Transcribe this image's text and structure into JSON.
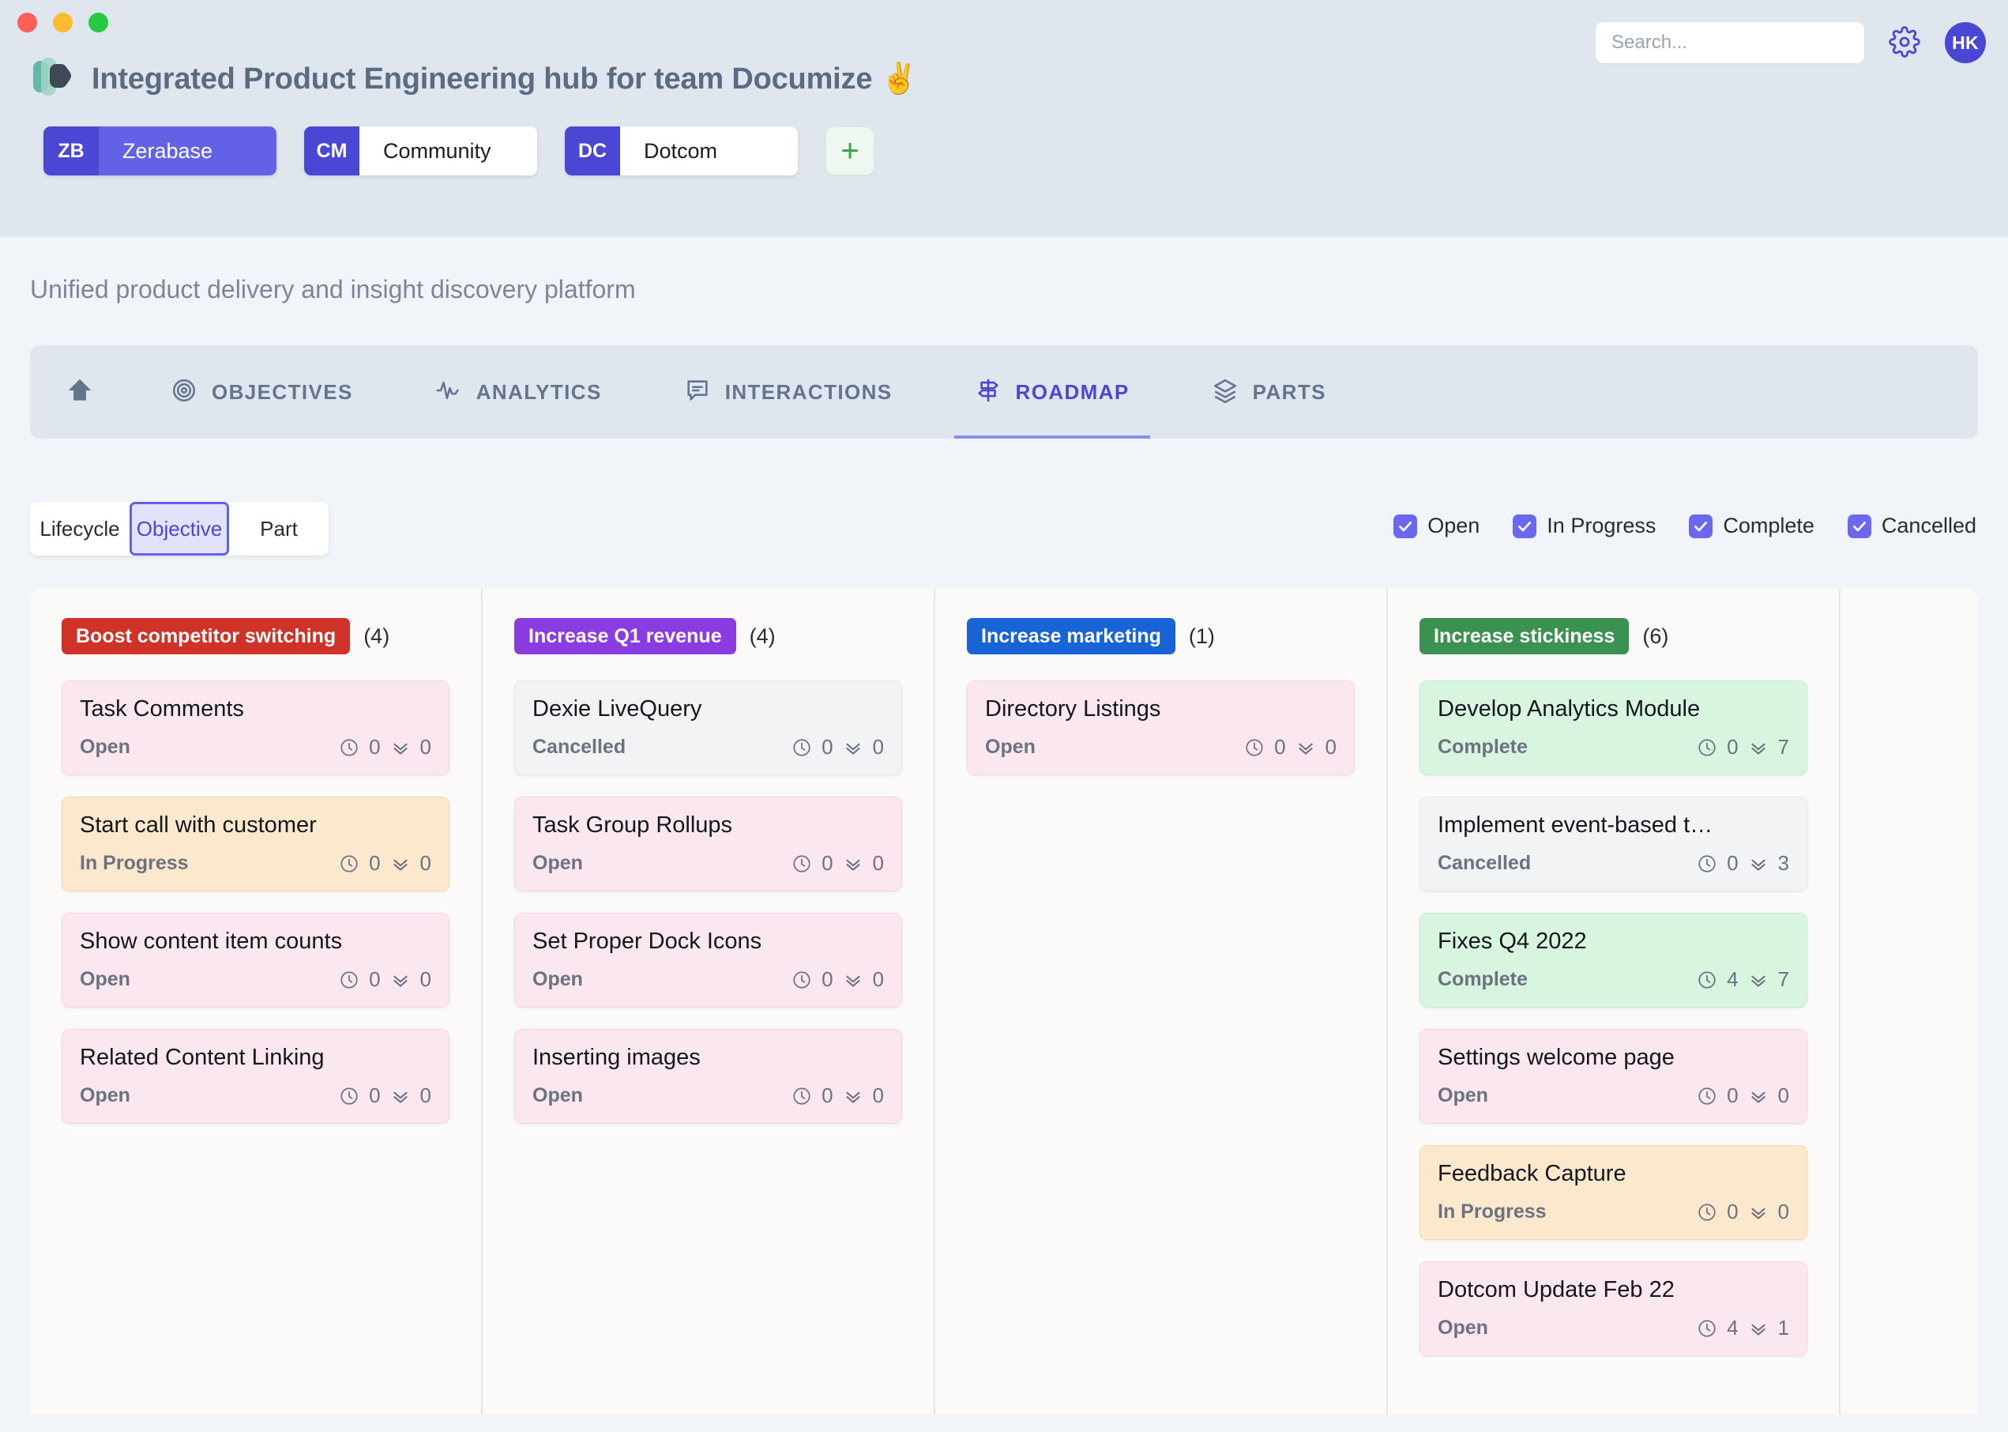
{
  "window": {
    "traffic_lights": [
      "close",
      "minimize",
      "maximize"
    ]
  },
  "header": {
    "title": "Integrated Product Engineering hub for team Documize ✌️",
    "logo_icon": "documize-logo-icon",
    "search": {
      "placeholder": "Search...",
      "value": ""
    },
    "settings_icon": "gear-icon",
    "avatar_initials": "HK"
  },
  "projects": {
    "items": [
      {
        "code": "ZB",
        "name": "Zerabase",
        "active": true
      },
      {
        "code": "CM",
        "name": "Community",
        "active": false
      },
      {
        "code": "DC",
        "name": "Dotcom",
        "active": false
      }
    ],
    "add_label": "+"
  },
  "subtitle": "Unified product delivery and insight discovery platform",
  "nav": {
    "items": [
      {
        "label": "",
        "icon": "home-icon",
        "active": false
      },
      {
        "label": "OBJECTIVES",
        "icon": "target-icon",
        "active": false
      },
      {
        "label": "ANALYTICS",
        "icon": "pulse-icon",
        "active": false
      },
      {
        "label": "INTERACTIONS",
        "icon": "comment-icon",
        "active": false
      },
      {
        "label": "ROADMAP",
        "icon": "signpost-icon",
        "active": true
      },
      {
        "label": "PARTS",
        "icon": "layers-icon",
        "active": false
      }
    ]
  },
  "group_by": {
    "options": [
      {
        "label": "Lifecycle",
        "active": false
      },
      {
        "label": "Objective",
        "active": true
      },
      {
        "label": "Part",
        "active": false
      }
    ]
  },
  "status_filters": [
    {
      "label": "Open",
      "checked": true
    },
    {
      "label": "In Progress",
      "checked": true
    },
    {
      "label": "Complete",
      "checked": true
    },
    {
      "label": "Cancelled",
      "checked": true
    }
  ],
  "board": {
    "columns": [
      {
        "chip_label": "Boost competitor switching",
        "chip_color": "#cf3327",
        "count": "(4)",
        "cards": [
          {
            "title": "Task Comments",
            "status": "Open",
            "theme": "open",
            "time": "0",
            "tasks": "0"
          },
          {
            "title": "Start call with customer",
            "status": "In Progress",
            "theme": "progress",
            "time": "0",
            "tasks": "0"
          },
          {
            "title": "Show content item counts",
            "status": "Open",
            "theme": "open",
            "time": "0",
            "tasks": "0"
          },
          {
            "title": "Related Content Linking",
            "status": "Open",
            "theme": "open",
            "time": "0",
            "tasks": "0"
          }
        ]
      },
      {
        "chip_label": "Increase Q1 revenue",
        "chip_color": "#8b3ce0",
        "count": "(4)",
        "cards": [
          {
            "title": "Dexie LiveQuery",
            "status": "Cancelled",
            "theme": "cancelled",
            "time": "0",
            "tasks": "0"
          },
          {
            "title": "Task Group Rollups",
            "status": "Open",
            "theme": "open",
            "time": "0",
            "tasks": "0"
          },
          {
            "title": "Set Proper Dock Icons",
            "status": "Open",
            "theme": "open",
            "time": "0",
            "tasks": "0"
          },
          {
            "title": "Inserting images",
            "status": "Open",
            "theme": "open",
            "time": "0",
            "tasks": "0"
          }
        ]
      },
      {
        "chip_label": "Increase marketing",
        "chip_color": "#1864d6",
        "count": "(1)",
        "cards": [
          {
            "title": "Directory Listings",
            "status": "Open",
            "theme": "open",
            "time": "0",
            "tasks": "0"
          }
        ]
      },
      {
        "chip_label": "Increase stickiness",
        "chip_color": "#3a9150",
        "count": "(6)",
        "cards": [
          {
            "title": "Develop Analytics Module",
            "status": "Complete",
            "theme": "complete",
            "time": "0",
            "tasks": "7"
          },
          {
            "title": "Implement event-based t…",
            "status": "Cancelled",
            "theme": "cancelled",
            "time": "0",
            "tasks": "3"
          },
          {
            "title": "Fixes Q4 2022",
            "status": "Complete",
            "theme": "complete",
            "time": "4",
            "tasks": "7"
          },
          {
            "title": "Settings welcome page",
            "status": "Open",
            "theme": "open",
            "time": "0",
            "tasks": "0"
          },
          {
            "title": "Feedback Capture",
            "status": "In Progress",
            "theme": "progress",
            "time": "0",
            "tasks": "0"
          },
          {
            "title": "Dotcom Update Feb 22",
            "status": "Open",
            "theme": "open",
            "time": "4",
            "tasks": "1"
          }
        ]
      }
    ]
  }
}
